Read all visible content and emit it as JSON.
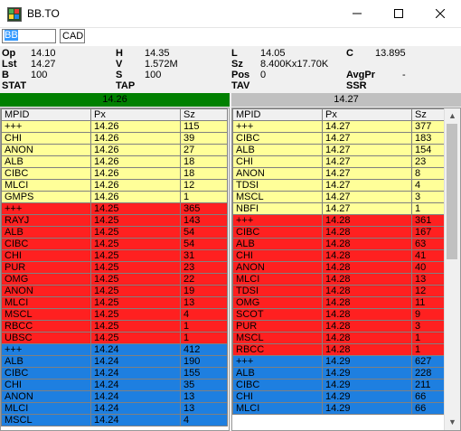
{
  "window": {
    "title": "BB.TO"
  },
  "toolbar": {
    "symbol": "BB",
    "currency": "CAD"
  },
  "quote": {
    "op_label": "Op",
    "op": "14.10",
    "h_label": "H",
    "h": "14.35",
    "l_label": "L",
    "l": "14.05",
    "c_label": "C",
    "c": "13.895",
    "lst_label": "Lst",
    "lst": "14.27",
    "v_label": "V",
    "v": "1.572M",
    "sz_label": "Sz",
    "sz": "8.400Kx17.70K",
    "b_label": "B",
    "b": "100",
    "s_label": "S",
    "s": "100",
    "pos_label": "Pos",
    "pos": "0",
    "avgpr_label": "AvgPr",
    "avgpr": "-",
    "stat_label": "STAT",
    "tap_label": "TAP",
    "tav_label": "TAV",
    "ssr_label": "SSR"
  },
  "bid_price": "14.26",
  "ask_price": "14.27",
  "columns": {
    "mpid": "MPID",
    "px": "Px",
    "sz": "Sz"
  },
  "bid_book": [
    {
      "m": "+++",
      "p": "14.26",
      "s": "115",
      "c": "yellow"
    },
    {
      "m": "CHI",
      "p": "14.26",
      "s": "39",
      "c": "yellow"
    },
    {
      "m": "ANON",
      "p": "14.26",
      "s": "27",
      "c": "yellow"
    },
    {
      "m": "ALB",
      "p": "14.26",
      "s": "18",
      "c": "yellow"
    },
    {
      "m": "CIBC",
      "p": "14.26",
      "s": "18",
      "c": "yellow"
    },
    {
      "m": "MLCI",
      "p": "14.26",
      "s": "12",
      "c": "yellow"
    },
    {
      "m": "GMPS",
      "p": "14.26",
      "s": "1",
      "c": "yellow"
    },
    {
      "m": "+++",
      "p": "14.25",
      "s": "365",
      "c": "red"
    },
    {
      "m": "RAYJ",
      "p": "14.25",
      "s": "143",
      "c": "red"
    },
    {
      "m": "ALB",
      "p": "14.25",
      "s": "54",
      "c": "red"
    },
    {
      "m": "CIBC",
      "p": "14.25",
      "s": "54",
      "c": "red"
    },
    {
      "m": "CHI",
      "p": "14.25",
      "s": "31",
      "c": "red"
    },
    {
      "m": "PUR",
      "p": "14.25",
      "s": "23",
      "c": "red"
    },
    {
      "m": "OMG",
      "p": "14.25",
      "s": "22",
      "c": "red"
    },
    {
      "m": "ANON",
      "p": "14.25",
      "s": "19",
      "c": "red"
    },
    {
      "m": "MLCI",
      "p": "14.25",
      "s": "13",
      "c": "red"
    },
    {
      "m": "MSCL",
      "p": "14.25",
      "s": "4",
      "c": "red"
    },
    {
      "m": "RBCC",
      "p": "14.25",
      "s": "1",
      "c": "red"
    },
    {
      "m": "UBSC",
      "p": "14.25",
      "s": "1",
      "c": "red"
    },
    {
      "m": "+++",
      "p": "14.24",
      "s": "412",
      "c": "blue"
    },
    {
      "m": "ALB",
      "p": "14.24",
      "s": "190",
      "c": "blue"
    },
    {
      "m": "CIBC",
      "p": "14.24",
      "s": "155",
      "c": "blue"
    },
    {
      "m": "CHI",
      "p": "14.24",
      "s": "35",
      "c": "blue"
    },
    {
      "m": "ANON",
      "p": "14.24",
      "s": "13",
      "c": "blue"
    },
    {
      "m": "MLCI",
      "p": "14.24",
      "s": "13",
      "c": "blue"
    },
    {
      "m": "MSCL",
      "p": "14.24",
      "s": "4",
      "c": "blue"
    }
  ],
  "ask_book": [
    {
      "m": "+++",
      "p": "14.27",
      "s": "377",
      "c": "yellow"
    },
    {
      "m": "CIBC",
      "p": "14.27",
      "s": "183",
      "c": "yellow"
    },
    {
      "m": "ALB",
      "p": "14.27",
      "s": "154",
      "c": "yellow"
    },
    {
      "m": "CHI",
      "p": "14.27",
      "s": "23",
      "c": "yellow"
    },
    {
      "m": "ANON",
      "p": "14.27",
      "s": "8",
      "c": "yellow"
    },
    {
      "m": "TDSI",
      "p": "14.27",
      "s": "4",
      "c": "yellow"
    },
    {
      "m": "MSCL",
      "p": "14.27",
      "s": "3",
      "c": "yellow"
    },
    {
      "m": "NBFI",
      "p": "14.27",
      "s": "1",
      "c": "yellow"
    },
    {
      "m": "+++",
      "p": "14.28",
      "s": "361",
      "c": "red"
    },
    {
      "m": "CIBC",
      "p": "14.28",
      "s": "167",
      "c": "red"
    },
    {
      "m": "ALB",
      "p": "14.28",
      "s": "63",
      "c": "red"
    },
    {
      "m": "CHI",
      "p": "14.28",
      "s": "41",
      "c": "red"
    },
    {
      "m": "ANON",
      "p": "14.28",
      "s": "40",
      "c": "red"
    },
    {
      "m": "MLCI",
      "p": "14.28",
      "s": "13",
      "c": "red"
    },
    {
      "m": "TDSI",
      "p": "14.28",
      "s": "12",
      "c": "red"
    },
    {
      "m": "OMG",
      "p": "14.28",
      "s": "11",
      "c": "red"
    },
    {
      "m": "SCOT",
      "p": "14.28",
      "s": "9",
      "c": "red"
    },
    {
      "m": "PUR",
      "p": "14.28",
      "s": "3",
      "c": "red"
    },
    {
      "m": "MSCL",
      "p": "14.28",
      "s": "1",
      "c": "red"
    },
    {
      "m": "RBCC",
      "p": "14.28",
      "s": "1",
      "c": "red"
    },
    {
      "m": "+++",
      "p": "14.29",
      "s": "627",
      "c": "blue"
    },
    {
      "m": "ALB",
      "p": "14.29",
      "s": "228",
      "c": "blue"
    },
    {
      "m": "CIBC",
      "p": "14.29",
      "s": "211",
      "c": "blue"
    },
    {
      "m": "CHI",
      "p": "14.29",
      "s": "66",
      "c": "blue"
    },
    {
      "m": "MLCI",
      "p": "14.29",
      "s": "66",
      "c": "blue"
    }
  ],
  "colors": {
    "bid_bar": "#008000",
    "ask_bar": "#c0c0c0",
    "level1": "#ffff99",
    "level2": "#ff2020",
    "level3": "#1e7fe0"
  },
  "icons": {
    "minimize": "minimize-icon",
    "maximize": "maximize-icon",
    "close": "close-icon"
  }
}
